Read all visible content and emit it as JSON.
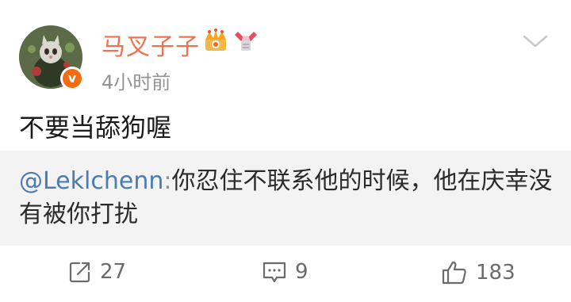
{
  "user": {
    "name": "马叉子子",
    "time": "4小时前"
  },
  "post": {
    "text": "不要当舔狗喔"
  },
  "repost": {
    "mention": "@Leklchenn",
    "separator": ":",
    "text": "你忍住不联系他的时候，他在庆幸没有被你打扰"
  },
  "actions": {
    "repost_count": "27",
    "comment_count": "9",
    "like_count": "183"
  },
  "colors": {
    "username": "#eb7350",
    "mention": "#4a7bb5",
    "verified": "#f36b12"
  }
}
